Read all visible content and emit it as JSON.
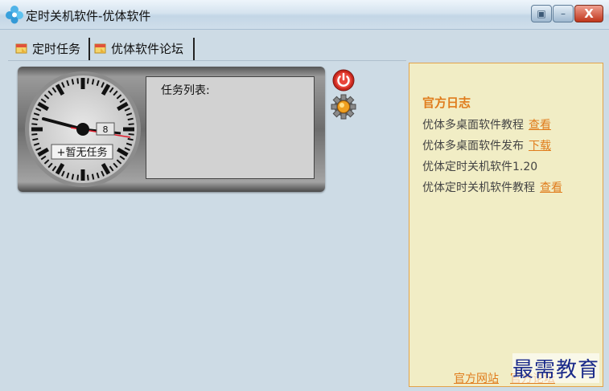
{
  "window": {
    "title": "定时关机软件-优体软件",
    "buttons": {
      "menu": "▣",
      "minimize": "–",
      "close": "X"
    }
  },
  "tabs": [
    {
      "label": "定时任务"
    },
    {
      "label": "优体软件论坛"
    }
  ],
  "clock": {
    "date_marker": "8",
    "status_label": "+暂无任务"
  },
  "task_list": {
    "label": "任务列表:"
  },
  "news": {
    "title": "官方日志",
    "items": [
      {
        "text": "优体多桌面软件教程",
        "link": "查看"
      },
      {
        "text": "优体多桌面软件发布",
        "link": "下载"
      },
      {
        "text": "优体定时关机软件1.20",
        "link": ""
      },
      {
        "text": "优体定时关机软件教程",
        "link": "查看"
      }
    ],
    "footer_links": [
      "官方网站",
      "官方论坛"
    ]
  },
  "watermark": "最需教育",
  "icons": [
    "app-logo-icon",
    "tab-task-icon",
    "tab-forum-icon",
    "power-icon",
    "settings-gear-icon"
  ],
  "colors": {
    "accent": "#e07c1c",
    "panel_bg": "#f1edc5",
    "window_bg": "#cddbe5"
  }
}
